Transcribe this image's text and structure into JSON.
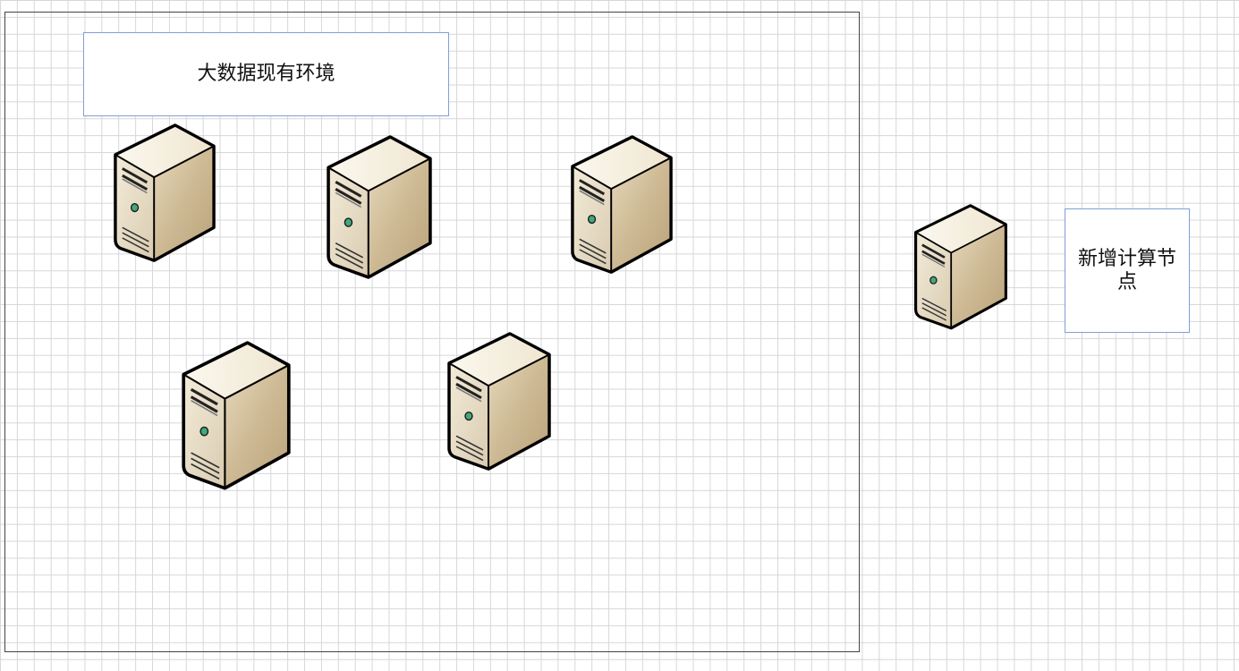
{
  "diagram": {
    "existing_environment": {
      "label": "大数据现有环境",
      "servers": [
        {
          "icon": "server-icon"
        },
        {
          "icon": "server-icon"
        },
        {
          "icon": "server-icon"
        },
        {
          "icon": "server-icon"
        },
        {
          "icon": "server-icon"
        }
      ]
    },
    "new_node": {
      "label": "新增计算节点",
      "server": {
        "icon": "server-icon"
      }
    }
  },
  "colors": {
    "grid": "#d7d7d7",
    "label_border": "#7f9fd6",
    "server_body_light": "#f3ecd9",
    "server_body_dark": "#b9a27c",
    "server_outline": "#000000",
    "power_led": "#3faa7a"
  }
}
